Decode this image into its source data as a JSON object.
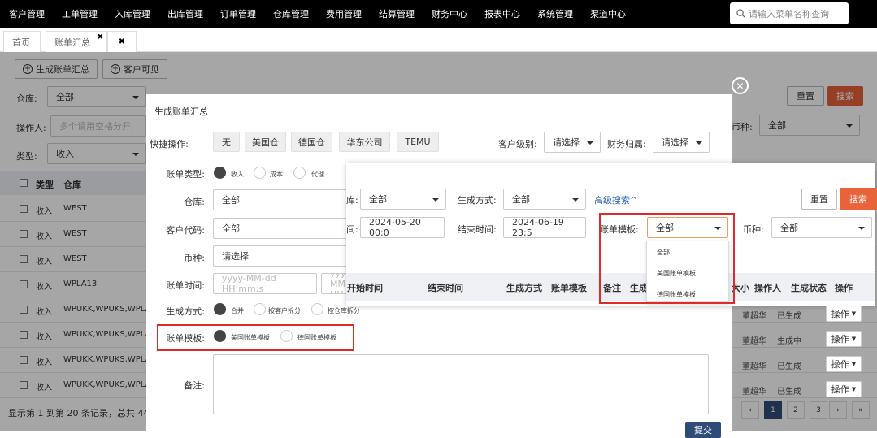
{
  "topnav": {
    "items": [
      "客户管理",
      "工单管理",
      "入库管理",
      "出库管理",
      "订单管理",
      "仓库管理",
      "费用管理",
      "结算管理",
      "财务中心",
      "报表中心",
      "系统管理",
      "渠道中心"
    ],
    "search_placeholder": "请输入菜单名称查询"
  },
  "tabs": {
    "home": "首页",
    "billing": "账单汇总",
    "close": "✖",
    "close2": "✖"
  },
  "page": {
    "btn_generate": "生成账单汇总",
    "btn_customer_visible": "客户可见",
    "label_warehouse": "仓库:",
    "warehouse_value": "全部",
    "label_operator": "操作人:",
    "operator_placeholder": "多个请用空格分开.",
    "label_type": "类型:",
    "type_value": "收入",
    "label_currency": "币种:",
    "currency_value": "全部",
    "btn_reset": "重置",
    "btn_search": "搜索",
    "col_type": "类型",
    "col_warehouse": "仓库",
    "rows": [
      {
        "type": "收入",
        "warehouse": "WEST"
      },
      {
        "type": "收入",
        "warehouse": "WEST"
      },
      {
        "type": "收入",
        "warehouse": "WEST"
      },
      {
        "type": "收入",
        "warehouse": "WPLA13"
      },
      {
        "type": "收入",
        "warehouse": "WPUKK,WPUKS,WPLA..."
      },
      {
        "type": "收入",
        "warehouse": "WPUKK,WPUKS,WPLA..."
      },
      {
        "type": "收入",
        "warehouse": "WPUKK,WPUKS,WPLA..."
      },
      {
        "type": "收入",
        "warehouse": "WPUKK,WPUKS,WPLA..."
      }
    ],
    "right_rows": [
      {
        "person": "董超华",
        "status": "已生成"
      },
      {
        "person": "董超华",
        "status": "生成中"
      },
      {
        "person": "董超华",
        "status": "已生成"
      },
      {
        "person": "董超华",
        "status": "已生成"
      }
    ],
    "op_label": "操作",
    "footer": "显示第 1 到第 20 条记录，总共 44 条",
    "pages": [
      "‹",
      "1",
      "2",
      "3",
      "›",
      "»"
    ]
  },
  "modal": {
    "title": "生成账单汇总",
    "quick_label": "快捷操作:",
    "quick": [
      "无",
      "美国仓",
      "德国仓",
      "华东公司",
      "TEMU"
    ],
    "customer_level_label": "客户级别:",
    "customer_level_value": "请选择",
    "finance_label": "财务归属:",
    "finance_value": "请选择",
    "bill_type_label": "账单类型:",
    "bill_types": [
      "收入",
      "成本",
      "代理"
    ],
    "warehouse_label": "仓库:",
    "warehouse_value": "全部",
    "customer_code_label": "客户代码:",
    "customer_code_value": "全部",
    "currency_label": "币种:",
    "currency_value": "请选择",
    "bill_time_label": "账单时间:",
    "bill_time_placeholder": "yyyy-MM-dd HH:mm:s",
    "gen_method_label": "生成方式:",
    "gen_methods": [
      "合并",
      "按客户拆分",
      "按仓库拆分"
    ],
    "template_label": "账单模板:",
    "templates": [
      "美国账单模板",
      "德国账单模板"
    ],
    "remark_label": "备注:",
    "submit": "提交"
  },
  "panel": {
    "warehouse_suffix": "库:",
    "warehouse_value": "全部",
    "gen_method_label": "生成方式:",
    "gen_method_value": "全部",
    "advanced": "高级搜索^",
    "btn_reset": "重置",
    "btn_search": "搜索",
    "start_suffix": "间:",
    "start_value": "2024-05-20 00:0",
    "end_label": "结束时间:",
    "end_value": "2024-06-19 23:5",
    "template_label": "账单模板:",
    "template_value": "全部",
    "currency_label": "币种:",
    "currency_value": "全部",
    "headers": [
      "开始时间",
      "结束时间",
      "生成方式",
      "账单模板",
      "备注",
      "生成",
      "大小",
      "操作人",
      "生成状态",
      "操作"
    ],
    "dropdown": [
      "全部",
      "美国账单模板",
      "德国账单模板"
    ]
  }
}
